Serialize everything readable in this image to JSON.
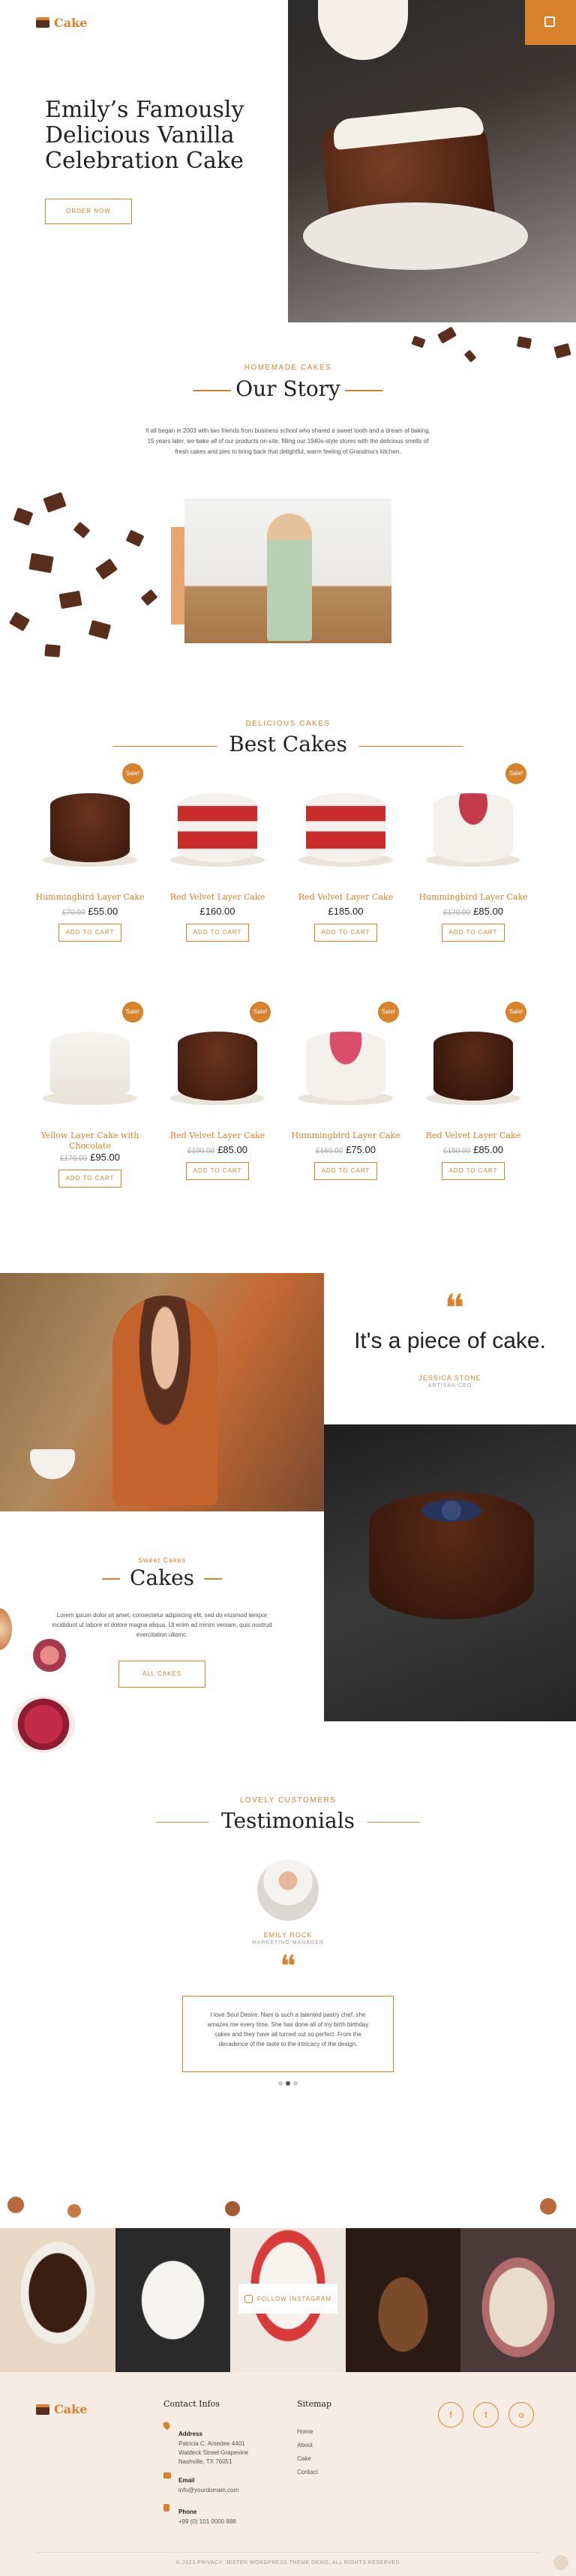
{
  "header": {
    "brand": "Cake",
    "menu_icon": "hamburger-icon",
    "cart_icon": "cart-icon"
  },
  "hero": {
    "title": "Emily’s Famously Delicious Vanilla Celebration Cake",
    "cta": "ORDER NOW"
  },
  "story": {
    "kicker": "HOMEMADE CAKES",
    "title": "Our Story",
    "text": "It all began in 2003 with two friends from business school who shared a sweet tooth and a dream of baking. 15 years later, we bake all of our products on-site, filling our 1940s-style stores with the delicious smells of fresh cakes and pies to bring back that delightful, warm feeling of Grandma’s kitchen."
  },
  "best": {
    "kicker": "DELICIOUS CAKES",
    "title": "Best Cakes",
    "sale_label": "Sale!",
    "cart_label": "ADD TO CART",
    "items": [
      {
        "name": "Hummingbird Layer Cake",
        "old": "£70.00",
        "price": "£55.00",
        "sale": true
      },
      {
        "name": "Red Velvet Layer Cake",
        "old": "",
        "price": "£160.00",
        "sale": false
      },
      {
        "name": "Red Velvet Layer Cake",
        "old": "",
        "price": "£185.00",
        "sale": false
      },
      {
        "name": "Hummingbird Layer Cake",
        "old": "£170.00",
        "price": "£85.00",
        "sale": true
      },
      {
        "name": "Yellow Layer Cake with Chocolate",
        "old": "£170.00",
        "price": "£95.00",
        "sale": true
      },
      {
        "name": "Red Velvet Layer Cake",
        "old": "£190.00",
        "price": "£85.00",
        "sale": true
      },
      {
        "name": "Hummingbird Layer Cake",
        "old": "£160.00",
        "price": "£75.00",
        "sale": true
      },
      {
        "name": "Red Velvet Layer Cake",
        "old": "£150.00",
        "price": "£85.00",
        "sale": true
      }
    ]
  },
  "quote": {
    "text": "It's a piece of cake.",
    "name": "JESSICA STONE",
    "role": "ARTISAN CEO"
  },
  "sweet": {
    "kicker": "Sweet Cakes",
    "title": "Cakes",
    "text": "Lorem ipsum dolor sit amet, consectetur adipiscing elit, sed do eiusmod tempor incididunt ut labore et dolore magna aliqua. Ut enim ad minim veniam, quis nostrud exercitation ullamc.",
    "cta": "ALL CAKES"
  },
  "testimonials": {
    "kicker": "LOVELY CUSTOMERS",
    "title": "Testimonials",
    "name": "EMILY ROCK",
    "role": "MARKETING MANAGER",
    "text": "I love Soul Desire. Nani is such a talented pastry chef. she amazes me every time. She has done all of my birth birthday cakes and they have all turned out so perfect. From the decadence of the taste to the intricacy of the design."
  },
  "instagram": {
    "label": "FOLLOW INSTAGRAM"
  },
  "footer": {
    "brand": "Cake",
    "contact": {
      "title": "Contact Infos",
      "address_label": "Address",
      "address": "Patricia C. Amedee 4401 Waldeck Street Grapevine Nashville, TX 76051",
      "email_label": "Email",
      "email": "info@yourdomain.com",
      "phone_label": "Phone",
      "phone": "+99 (0) 101 0000 888"
    },
    "sitemap": {
      "title": "Sitemap",
      "links": [
        "Home",
        "About",
        "Cake",
        "Contact"
      ]
    },
    "social": [
      "f",
      "t",
      "o"
    ],
    "copyright": "© 2023 PRIVACY, JESTER WORDPRESS THEME DEMO, ALL RIGHTS RESERVED"
  },
  "colors": {
    "accent": "#d9822b",
    "dark": "#222222",
    "cream": "#f7ece3"
  }
}
